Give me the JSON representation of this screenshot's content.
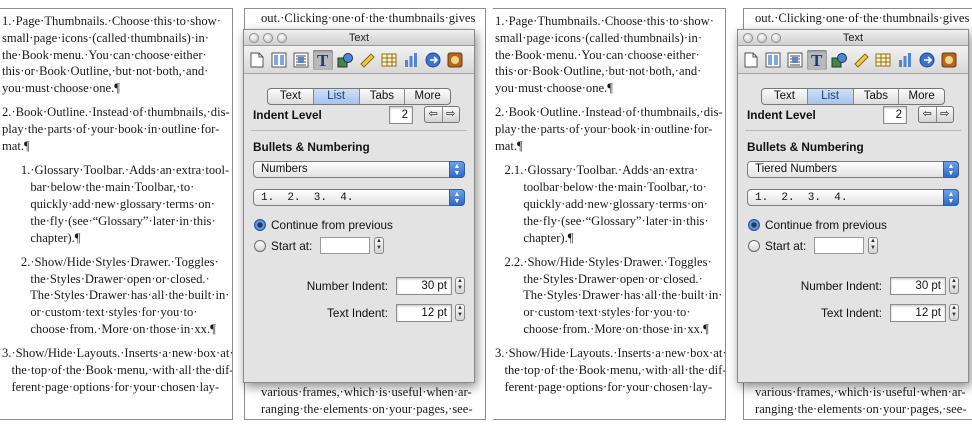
{
  "left": {
    "column_a": [
      "1.·Page·Thumbnails.·Choose·this·to·show·",
      "small·page·icons·(called·thumbnails)·in·",
      "the·Book·menu.·You·can·choose·either·",
      "this·or·Book·Outline,·but·not·both,·and·",
      "you·must·choose·one.¶",
      "",
      "2.·Book·Outline.·Instead·of·thumbnails,·dis-",
      "play·the·parts·of·your·book·in·outline·for-",
      "mat.¶",
      "",
      "      1.·Glossary·Toolbar.·Adds·an·extra·tool-",
      "         bar·below·the·main·Toolbar,·to·",
      "         quickly·add·new·glossary·terms·on·",
      "         the·fly·(see·“Glossary”·later·in·this·",
      "         chapter).¶",
      "",
      "      2.·Show/Hide·Styles·Drawer.·Toggles·",
      "         the·Styles·Drawer·open·or·closed.·",
      "         The·Styles·Drawer·has·all·the·built·in·",
      "         or·custom·text·styles·for·you·to·",
      "         choose·from.·More·on·those·in·xx.¶",
      "",
      "3.·Show/Hide·Layouts.·Inserts·a·new·box·at·",
      "   the·top·of·the·Book·menu,·with·all·the·dif-",
      "   ferent·page·options·for·your·chosen·lay-"
    ],
    "column_b_top": "out.·Clicking·one·of·the·thumbnails·gives",
    "column_b_bottom": [
      "various·frames,·which·is·useful·when·ar-",
      "ranging·the·elements·on·your·pages,·see-"
    ],
    "inspector": {
      "title": "Text",
      "tabs": [
        "Text",
        "List",
        "Tabs",
        "More"
      ],
      "selected_tab": "List",
      "indent_level_label": "Indent Level",
      "indent_level_value": "2",
      "bullets_label": "Bullets & Numbering",
      "style_popup": "Numbers",
      "format_popup": "1.  2.  3.  4.",
      "continue_label": "Continue from previous",
      "start_at_label": "Start at:",
      "number_indent_label": "Number Indent:",
      "number_indent_value": "30 pt",
      "text_indent_label": "Text Indent:",
      "text_indent_value": "12 pt"
    }
  },
  "right": {
    "column_a": [
      "1.·Page·Thumbnails.·Choose·this·to·show·",
      "small·page·icons·(called·thumbnails)·in·",
      "the·Book·menu.·You·can·choose·either·",
      "this·or·Book·Outline,·but·not·both,·and·",
      "you·must·choose·one.¶",
      "",
      "2.·Book·Outline.·Instead·of·thumbnails,·dis-",
      "play·the·parts·of·your·book·in·outline·for-",
      "mat.¶",
      "",
      "   2.1.·Glossary·Toolbar.·Adds·an·extra·",
      "         toolbar·below·the·main·Toolbar,·to·",
      "         quickly·add·new·glossary·terms·on·",
      "         the·fly·(see·“Glossary”·later·in·this·",
      "         chapter).¶",
      "",
      "   2.2.·Show/Hide·Styles·Drawer.·Toggles·",
      "         the·Styles·Drawer·open·or·closed.·",
      "         The·Styles·Drawer·has·all·the·built·in·",
      "         or·custom·text·styles·for·you·to·",
      "         choose·from.·More·on·those·in·xx.¶",
      "",
      "3.·Show/Hide·Layouts.·Inserts·a·new·box·at·",
      "   the·top·of·the·Book·menu,·with·all·the·dif-",
      "   ferent·page·options·for·your·chosen·lay-"
    ],
    "column_b_top": "out.·Clicking·one·of·the·thumbnails·gives",
    "column_b_bottom": [
      "various·frames,·which·is·useful·when·ar-",
      "ranging·the·elements·on·your·pages,·see-"
    ],
    "inspector": {
      "title": "Text",
      "tabs": [
        "Text",
        "List",
        "Tabs",
        "More"
      ],
      "selected_tab": "List",
      "indent_level_label": "Indent Level",
      "indent_level_value": "2",
      "bullets_label": "Bullets & Numbering",
      "style_popup": "Tiered Numbers",
      "format_popup": "1.  2.  3.  4.",
      "continue_label": "Continue from previous",
      "start_at_label": "Start at:",
      "number_indent_label": "Number Indent:",
      "number_indent_value": "30 pt",
      "text_indent_label": "Text Indent:",
      "text_indent_value": "12 pt"
    }
  },
  "toolbar_icons": [
    "document-icon",
    "layout-icon",
    "wrap-icon",
    "text-icon",
    "graphic-icon",
    "ruler-icon",
    "table-icon",
    "chart-icon",
    "link-icon",
    "qt-icon"
  ],
  "colors": {
    "selected_tab": "#a6c3ea",
    "popup_caret": "#2d69c9",
    "window_bg": "#e3e3e3"
  }
}
